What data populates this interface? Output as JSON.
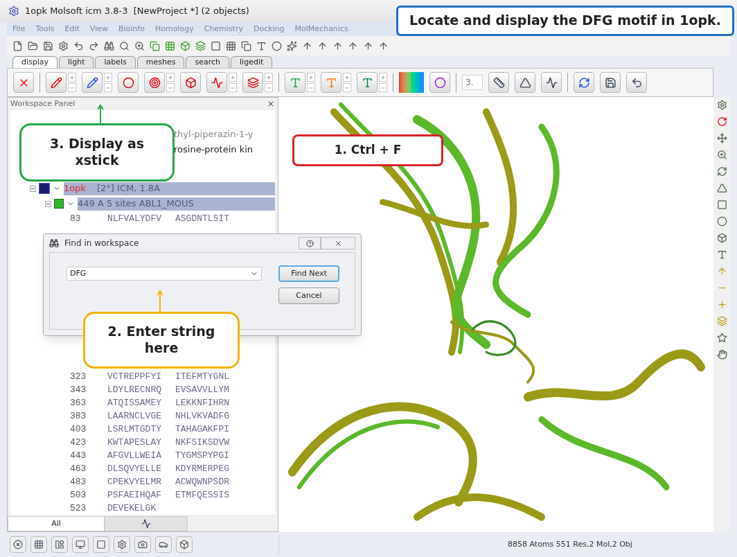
{
  "window": {
    "title": "1opk Molsoft icm 3.8-3  [NewProject *] (2 objects)"
  },
  "menu": [
    "File",
    "Tools",
    "Edit",
    "View",
    "Bioinfo",
    "Homology",
    "Chemistry",
    "Docking",
    "MolMechanics"
  ],
  "tabs": [
    {
      "label": "display",
      "selected": true
    },
    {
      "label": "light",
      "selected": false
    },
    {
      "label": "labels",
      "selected": false
    },
    {
      "label": "meshes",
      "selected": false
    },
    {
      "label": "search",
      "selected": false
    },
    {
      "label": "ligedit",
      "selected": false
    }
  ],
  "toolbar": {
    "spin_value": "3."
  },
  "workspace_panel": {
    "title": "Workspace Panel",
    "tree": [
      {
        "kind": "ligand",
        "label": "thyl-piperazin-1-y"
      },
      {
        "kind": "protein",
        "label": "rosine-protein kin"
      },
      {
        "kind": "object",
        "name": "1opk",
        "info": "[2°] ICM, 1.8A",
        "selected": true,
        "expanded": true,
        "children": [
          {
            "kind": "chain",
            "info": "449 A  5 sites ABL1_MOUS",
            "selected": true,
            "expanded": true
          }
        ]
      }
    ],
    "sequence": [
      {
        "start": "83",
        "blocks": [
          "NLFVALYDFV",
          "ASGDNTLSIT"
        ]
      },
      {
        "start": "323",
        "blocks": [
          "VCTREPPFYI",
          "ITEFMTYGNL"
        ]
      },
      {
        "start": "343",
        "blocks": [
          "LDYLRECNRQ",
          "EVSAVVLLYM"
        ]
      },
      {
        "start": "363",
        "blocks": [
          "ATQISSAMEY",
          "LEKKNFIHRN"
        ]
      },
      {
        "start": "383",
        "blocks": [
          "LAARNCLVGE",
          "NHLVKVADFG"
        ]
      },
      {
        "start": "403",
        "blocks": [
          "LSRLMTGDTY",
          "TAHAGAKFPI"
        ]
      },
      {
        "start": "423",
        "blocks": [
          "KWTAPESLAY",
          "NKFSIKSDVW"
        ]
      },
      {
        "start": "443",
        "blocks": [
          "AFGVLLWEIA",
          "TYGMSPYPGI"
        ]
      },
      {
        "start": "463",
        "blocks": [
          "DLSQVYELLE",
          "KDYRMERPEG"
        ]
      },
      {
        "start": "483",
        "blocks": [
          "CPEKVYELMR",
          "ACWQWNPSDR"
        ]
      },
      {
        "start": "503",
        "blocks": [
          "PSFAEIHQAF",
          "ETMFQESSIS"
        ]
      },
      {
        "start": "523",
        "blocks": [
          "DEVEKELGK"
        ]
      }
    ]
  },
  "bottom_tabs": [
    {
      "kind": "text",
      "label": "All",
      "selected": true
    },
    {
      "kind": "icon",
      "selected": false
    }
  ],
  "find_dialog": {
    "title": "Find in workspace",
    "value": "DFG",
    "buttons": [
      {
        "label": "Find Next",
        "default": true
      },
      {
        "label": "Cancel",
        "default": false
      }
    ]
  },
  "callouts": [
    {
      "text": "Locate and display the DFG motif in 1opk.",
      "color": "#1f6fc0"
    },
    {
      "text": "1. Ctrl + F",
      "color": "#d9222a"
    },
    {
      "text": "2. Enter string here",
      "color": "#f0b400"
    },
    {
      "text": "3. Display as xstick",
      "color": "#22a84a"
    }
  ],
  "status_bar": {
    "text": "8858 Atoms 551 Res,2 Mol,2 Obj"
  }
}
